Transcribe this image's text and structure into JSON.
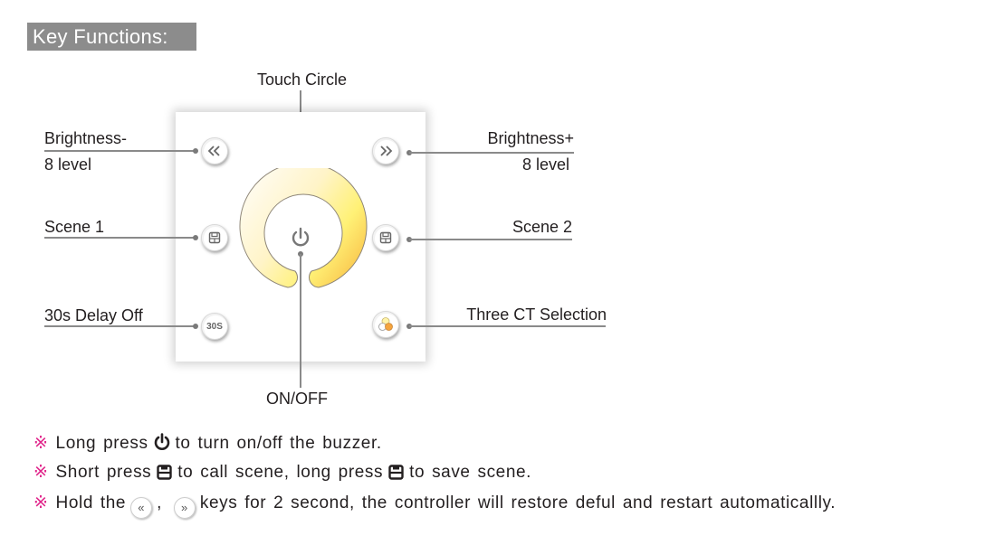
{
  "section_title": "Key Functions:",
  "callouts": {
    "touch_circle": "Touch Circle",
    "on_off": "ON/OFF",
    "brightness_minus": {
      "line1": "Brightness-",
      "line2": "8 level"
    },
    "brightness_plus": {
      "line1": "Brightness+",
      "line2": "8 level"
    },
    "scene1": "Scene 1",
    "scene2": "Scene 2",
    "delay_off": "30s Delay Off",
    "three_ct": "Three CT Selection"
  },
  "keys": {
    "delay_label": "30S"
  },
  "colors": {
    "ring_start": "#fffbee",
    "ring_mid": "#fff176",
    "ring_end": "#f7b13a",
    "note_mark": "#e0248a",
    "title_bg": "#8c8c8c"
  },
  "notes": [
    {
      "mark": "※",
      "pre": "Long press",
      "post": "to turn on/off the buzzer."
    },
    {
      "mark": "※",
      "pre": "Short press",
      "mid": "to call scene, long press",
      "post": "to save scene."
    },
    {
      "mark": "※",
      "pre": "Hold the",
      "sep": ",",
      "post": "keys for 2 second, the controller will restore deful and restart automaticallly."
    }
  ],
  "note_icons": {
    "left": "«",
    "right": "»"
  }
}
